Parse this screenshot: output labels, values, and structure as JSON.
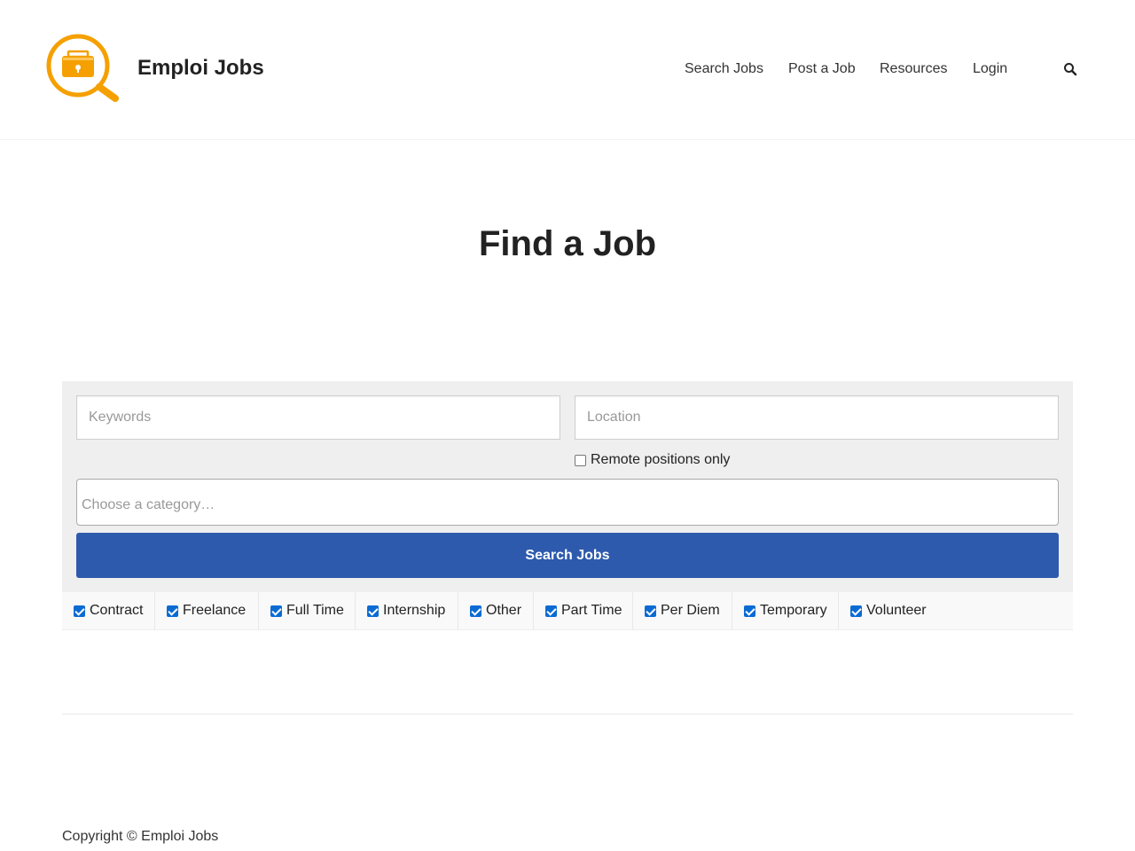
{
  "header": {
    "site_title": "Emploi Jobs",
    "logo_icon": "briefcase-magnifier-icon",
    "brand_color": "#f5a000",
    "nav": [
      {
        "label": "Search Jobs"
      },
      {
        "label": "Post a Job"
      },
      {
        "label": "Resources"
      },
      {
        "label": "Login"
      }
    ],
    "search_icon": "search-icon"
  },
  "page": {
    "title": "Find a Job"
  },
  "search_form": {
    "keywords_placeholder": "Keywords",
    "location_placeholder": "Location",
    "remote_label": "Remote positions only",
    "remote_checked": false,
    "category_placeholder": "Choose a category…",
    "submit_label": "Search Jobs",
    "button_color": "#2d5aad"
  },
  "job_types": [
    {
      "label": "Contract",
      "checked": true
    },
    {
      "label": "Freelance",
      "checked": true
    },
    {
      "label": "Full Time",
      "checked": true
    },
    {
      "label": "Internship",
      "checked": true
    },
    {
      "label": "Other",
      "checked": true
    },
    {
      "label": "Part Time",
      "checked": true
    },
    {
      "label": "Per Diem",
      "checked": true
    },
    {
      "label": "Temporary",
      "checked": true
    },
    {
      "label": "Volunteer",
      "checked": true
    }
  ],
  "footer": {
    "copyright": "Copyright © Emploi Jobs"
  }
}
